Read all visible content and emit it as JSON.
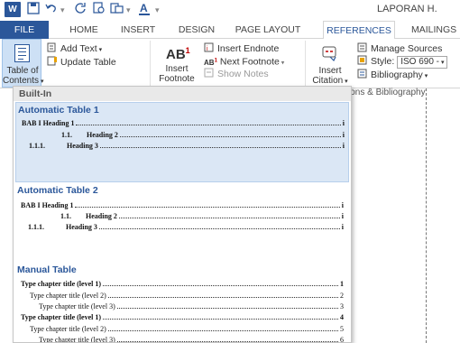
{
  "titlebar": {
    "app_icon": "W",
    "doc_title": "LAPORAN H."
  },
  "tabs": {
    "file": "FILE",
    "home": "HOME",
    "insert": "INSERT",
    "design": "DESIGN",
    "page_layout": "PAGE LAYOUT",
    "references": "REFERENCES",
    "mailings": "MAILINGS"
  },
  "ribbon": {
    "toc_label_1": "Table of",
    "toc_label_2": "Contents",
    "add_text": "Add Text",
    "update_table": "Update Table",
    "insert_footnote_1": "Insert",
    "insert_footnote_2": "Footnote",
    "insert_endnote": "Insert Endnote",
    "next_footnote": "Next Footnote",
    "show_notes": "Show Notes",
    "insert_citation_1": "Insert",
    "insert_citation_2": "Citation",
    "manage_sources": "Manage Sources",
    "style_label": "Style:",
    "style_value": "ISO 690 -",
    "bibliography": "Bibliography",
    "group_label_citations": "ions & Bibliography"
  },
  "gallery": {
    "header": "Built-In",
    "sections": [
      {
        "title": "Automatic Table 1",
        "lines": [
          {
            "num": "",
            "text": "BAB I Heading 1",
            "page": "i"
          },
          {
            "num": "1.1.",
            "text": "Heading 2",
            "page": "i"
          },
          {
            "num": "1.1.1.",
            "text": "Heading 3",
            "page": "i"
          }
        ]
      },
      {
        "title": "Automatic Table 2",
        "lines": [
          {
            "num": "",
            "text": "BAB I Heading 1",
            "page": "i"
          },
          {
            "num": "1.1.",
            "text": "Heading 2",
            "page": "i"
          },
          {
            "num": "1.1.1.",
            "text": "Heading 3",
            "page": "i"
          }
        ]
      },
      {
        "title": "Manual Table",
        "lines": [
          {
            "text": "Type chapter title (level 1)",
            "page": "1"
          },
          {
            "text": "Type chapter title (level 2)",
            "page": "2"
          },
          {
            "text": "Type chapter title (level 3)",
            "page": "3"
          },
          {
            "text": "Type chapter title (level 1)",
            "page": "4"
          },
          {
            "text": "Type chapter title (level 2)",
            "page": "5"
          },
          {
            "text": "Type chapter title (level 3)",
            "page": "6"
          }
        ]
      }
    ]
  },
  "colors": {
    "accent": "#2b579a",
    "selected_bg": "#dbe7f5"
  }
}
